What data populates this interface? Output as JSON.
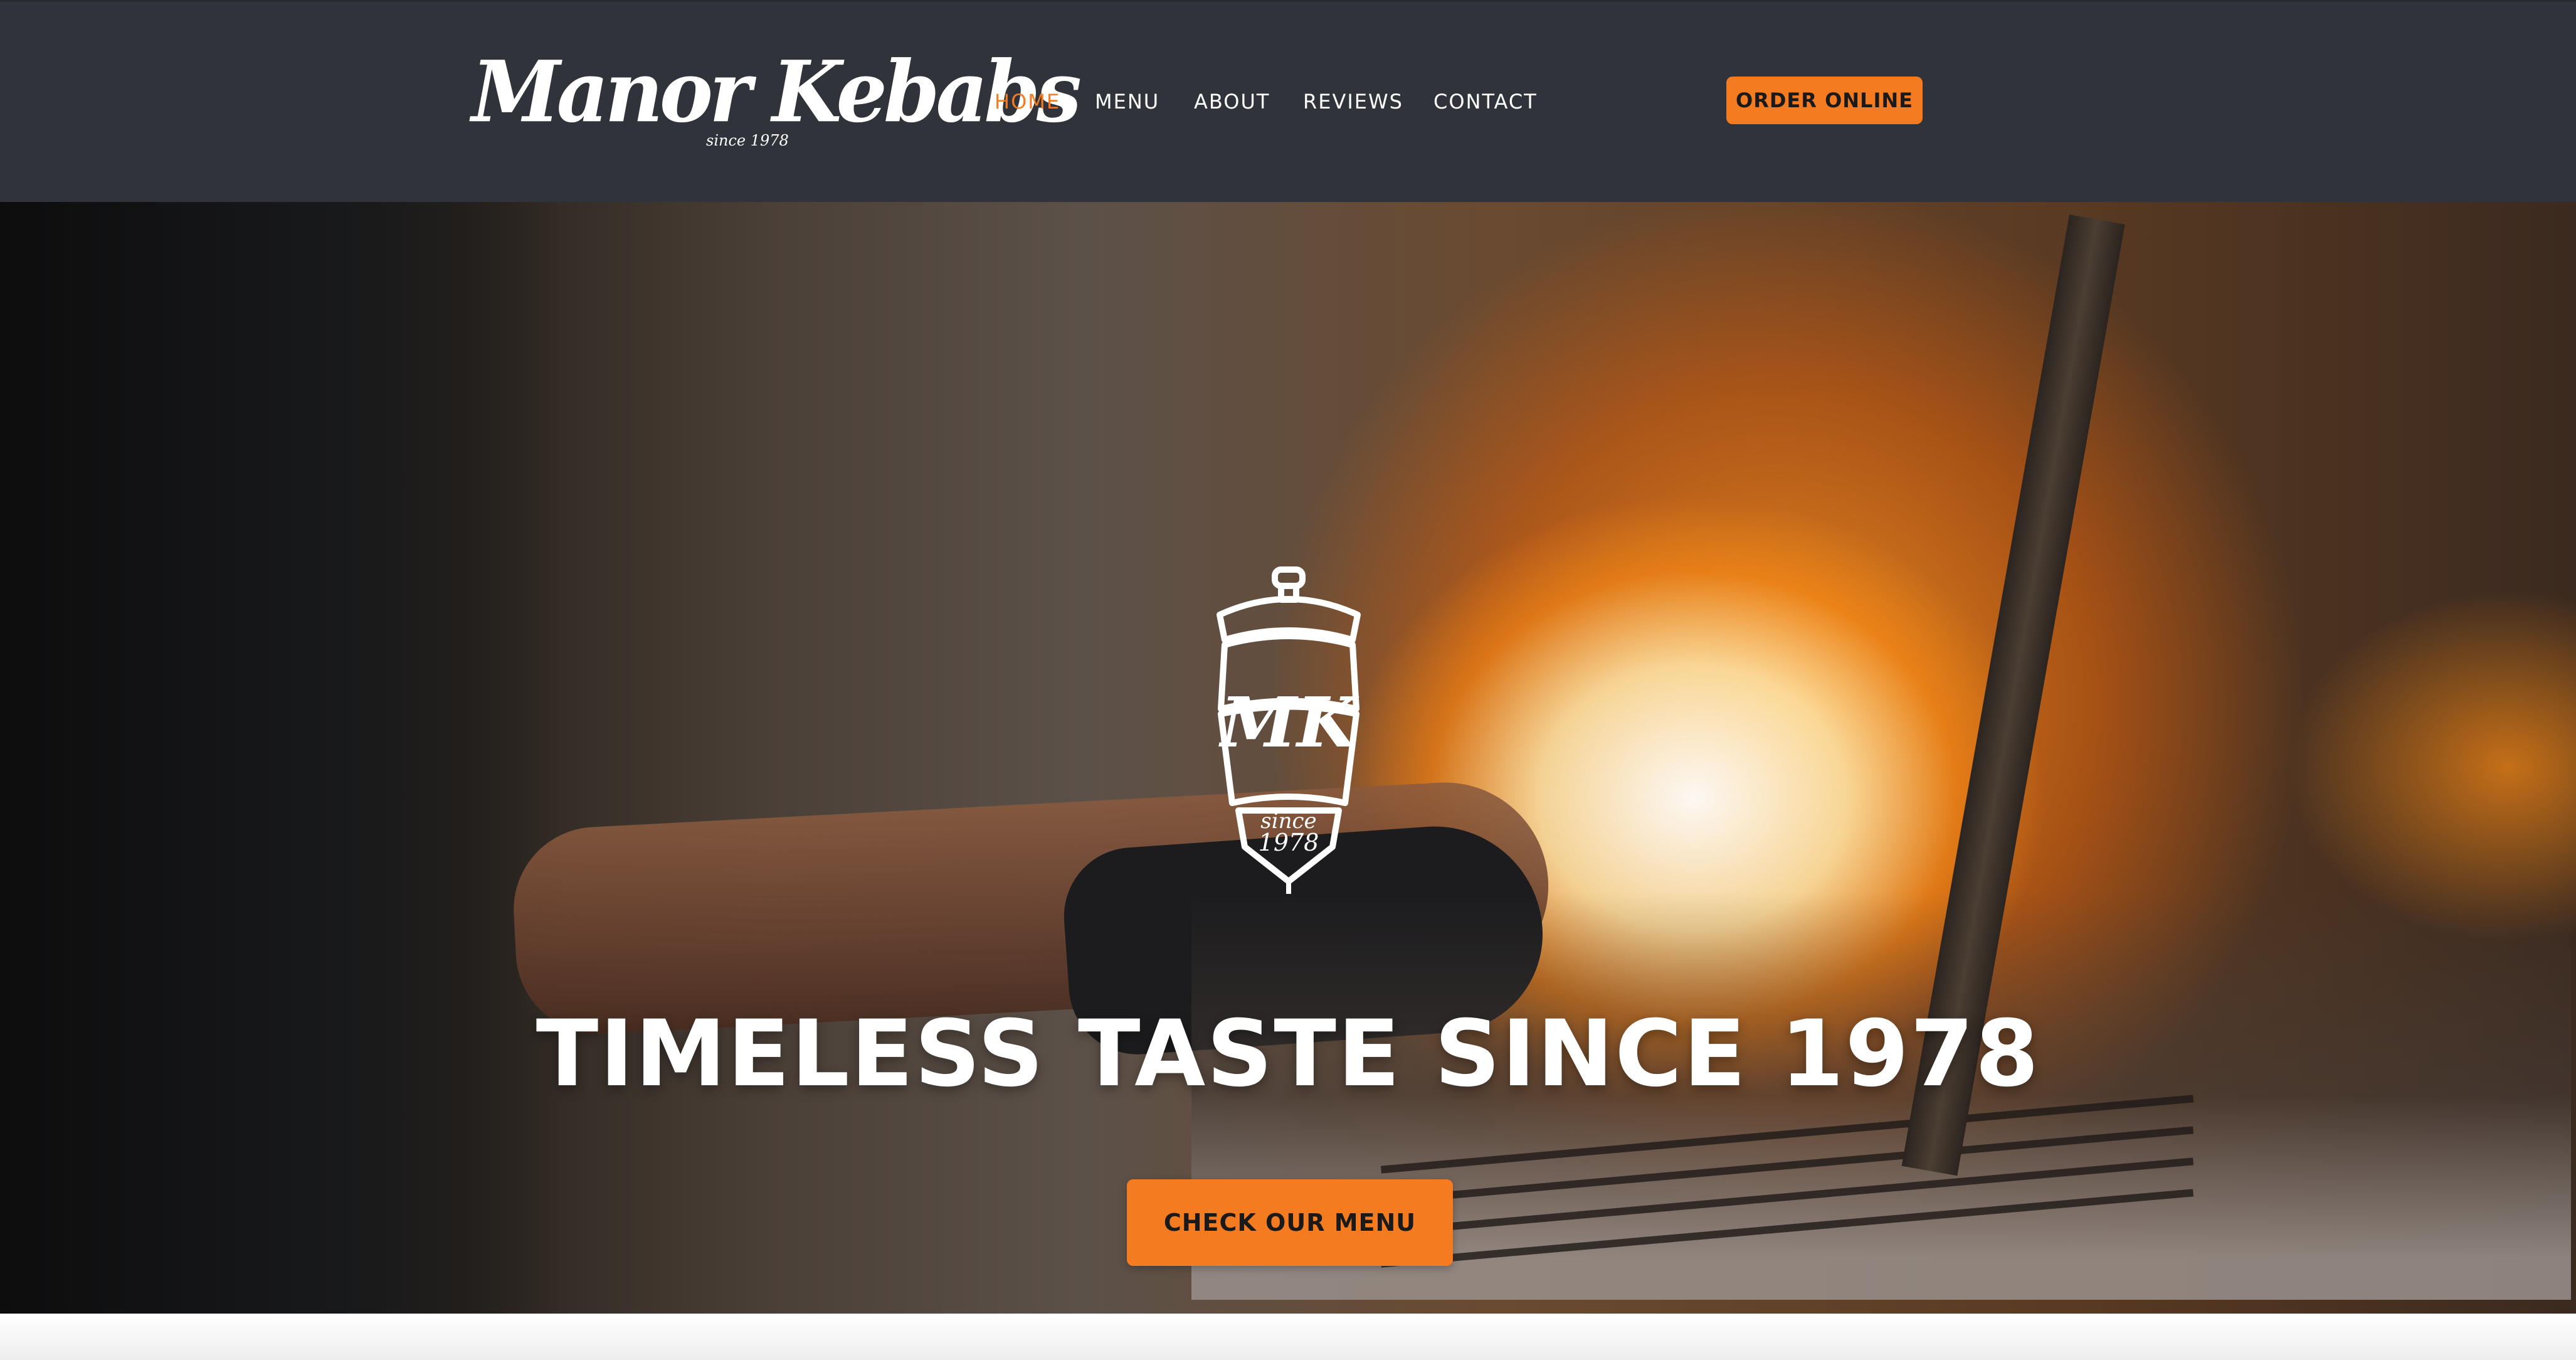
{
  "header": {
    "logo": {
      "wordmark": "Manor Kebabs",
      "since": "since 1978"
    },
    "nav": [
      {
        "label": "HOME",
        "active": true
      },
      {
        "label": "MENU",
        "active": false
      },
      {
        "label": "ABOUT",
        "active": false
      },
      {
        "label": "REVIEWS",
        "active": false
      },
      {
        "label": "CONTACT",
        "active": false
      }
    ],
    "order_button": "ORDER ONLINE"
  },
  "hero": {
    "emblem": {
      "monogram": "MK",
      "since_word": "since",
      "since_year": "1978"
    },
    "title": "TIMELESS TASTE SINCE 1978",
    "cta": "CHECK OUR MENU"
  },
  "colors": {
    "header_bg": "#30343a",
    "accent": "#f47b20",
    "nav_text": "#ffffff",
    "button_text": "#1a1a1a"
  }
}
